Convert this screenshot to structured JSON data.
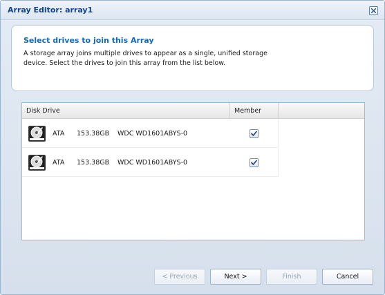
{
  "window": {
    "title": "Array Editor: array1"
  },
  "header": {
    "title": "Select drives to join this Array",
    "description": "A storage array joins multiple drives to appear as a single, unified storage device. Select the drives to join this array from the list below."
  },
  "grid": {
    "columns": {
      "disk_drive": "Disk Drive",
      "member": "Member"
    },
    "rows": [
      {
        "icon": "hard-drive-icon",
        "interface": "ATA",
        "size": "153.38GB",
        "model": "WDC WD1601ABYS-0",
        "member": true
      },
      {
        "icon": "hard-drive-icon",
        "interface": "ATA",
        "size": "153.38GB",
        "model": "WDC WD1601ABYS-0",
        "member": true
      }
    ]
  },
  "buttons": {
    "previous": "< Previous",
    "next": "Next >",
    "finish": "Finish",
    "cancel": "Cancel"
  },
  "colors": {
    "title_text": "#15428b",
    "header_title": "#1668b3",
    "grid_border": "#99bbe8"
  }
}
